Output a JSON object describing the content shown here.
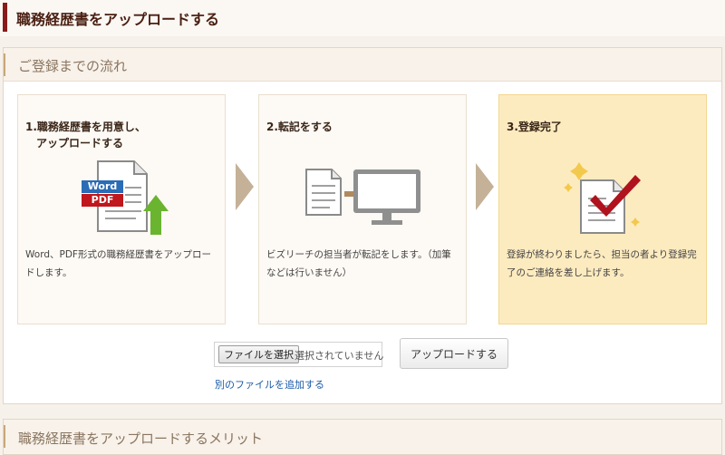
{
  "header": {
    "title": "職務経歴書をアップロードする"
  },
  "flow": {
    "title": "ご登録までの流れ"
  },
  "steps": [
    {
      "title_line1": "1.職務経歴書を用意し、",
      "title_line2": "アップロードする",
      "word_label": "Word",
      "pdf_label": "PDF",
      "description": "Word、PDF形式の職務経歴書をアップロードします。"
    },
    {
      "title_line1": "2.転記をする",
      "description": "ビズリーチの担当者が転記をします。（加筆などは行いません）"
    },
    {
      "title_line1": "3.登録完了",
      "description": "登録が終わりましたら、担当の者より登録完了のご連絡を差し上げます。"
    }
  ],
  "file": {
    "choose_label": "ファイルを選択",
    "status": "選択されていません"
  },
  "upload": {
    "label": "アップロードする"
  },
  "add_file": {
    "label": "別のファイルを追加する"
  },
  "merit": {
    "title": "職務経歴書をアップロードするメリット"
  },
  "colors": {
    "brand": "#8b1a1a",
    "step_active_bg": "#fdebc0",
    "link": "#1a5aa6",
    "arrow": "#c4b197",
    "word_blue": "#2a6cb5",
    "pdf_red": "#c0161c",
    "upload_green": "#6ab430"
  }
}
